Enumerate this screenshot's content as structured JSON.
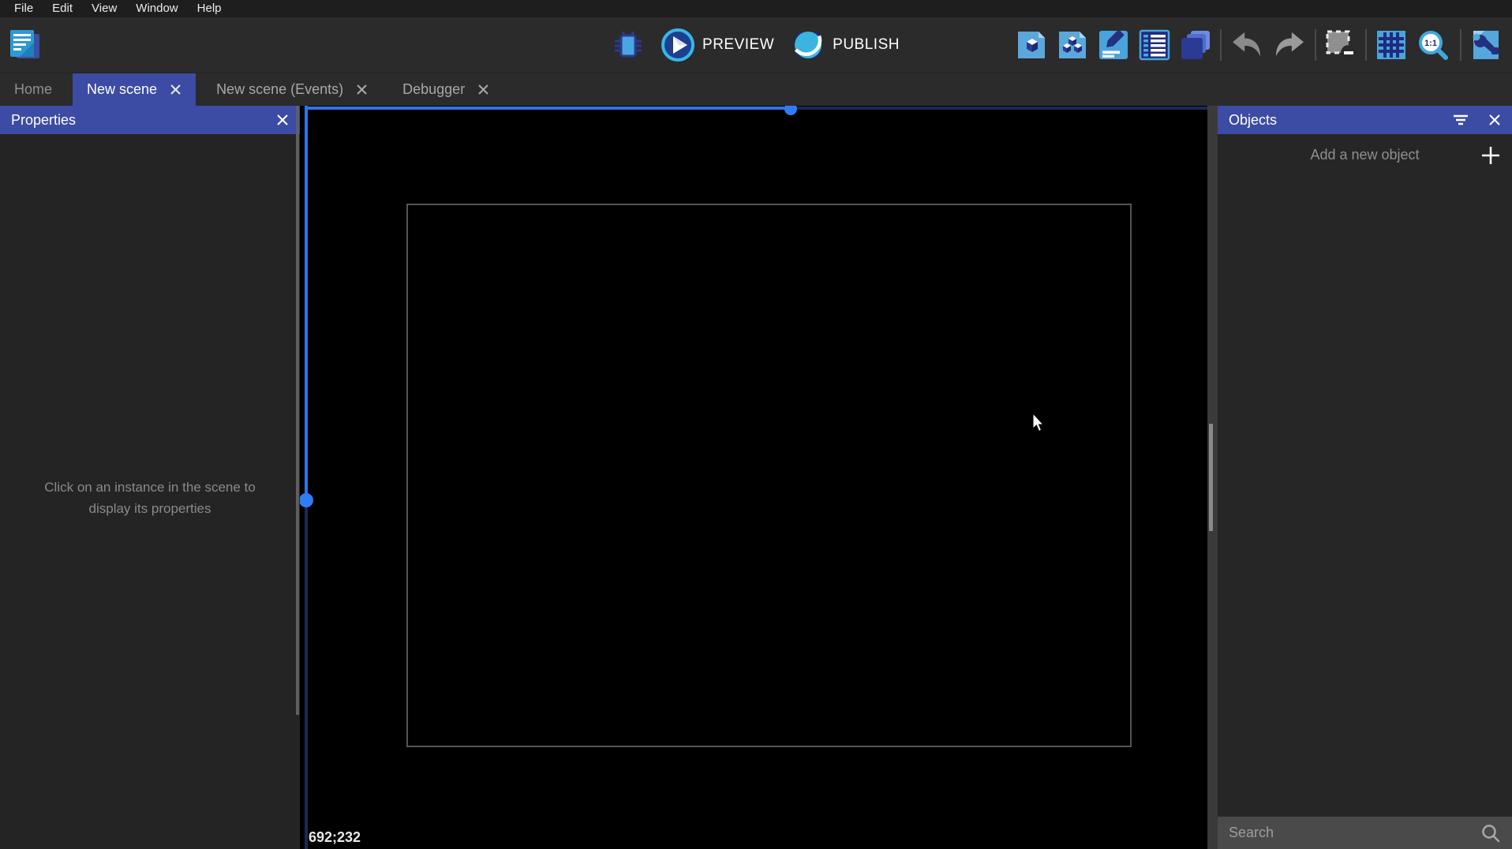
{
  "menubar": {
    "items": [
      "File",
      "Edit",
      "View",
      "Window",
      "Help"
    ]
  },
  "toolbar": {
    "preview_label": "PREVIEW",
    "publish_label": "PUBLISH"
  },
  "tabs": {
    "home": "Home",
    "scene": "New scene",
    "events": "New scene (Events)",
    "debugger": "Debugger"
  },
  "properties_panel": {
    "title": "Properties",
    "empty_message": [
      "Click on an instance in the scene to",
      "display its properties"
    ]
  },
  "canvas": {
    "cursor_coordinates": "692;232"
  },
  "objects_panel": {
    "title": "Objects",
    "add_button_label": "Add a new object",
    "search_placeholder": "Search"
  },
  "icons": {
    "app_logo": "stacked blue document pages",
    "debug": "bug",
    "preview": "play circle",
    "publish": "globe sphere",
    "edit_objects": "page with cube",
    "edit_groups": "page with three cubes",
    "edit_properties": "pencil on panel",
    "instances_list": "list panel",
    "layers": "stacked squares",
    "undo": "arrow left",
    "redo": "arrow right",
    "deselect": "dashed square minus",
    "grid": "grid",
    "zoom_original": "magnifier 1:1",
    "wrench": "wrench on page",
    "filter": "filter lines",
    "close": "x",
    "add": "plus",
    "search": "magnifier"
  },
  "colors": {
    "accent_indigo": "#3c4ba3",
    "menubar_bg": "#1e1e1e",
    "toolbar_bg": "#2b2b2b",
    "panel_bg": "#252525",
    "canvas_bg": "#000000",
    "scroll_blue_bright": "#2f74e8",
    "scroll_blue_dark": "#1a2a55",
    "scene_border": "#545454",
    "search_bg": "#4a4a4a",
    "icon_blue_light": "#4aa3dc",
    "icon_blue_dark": "#24307d"
  }
}
